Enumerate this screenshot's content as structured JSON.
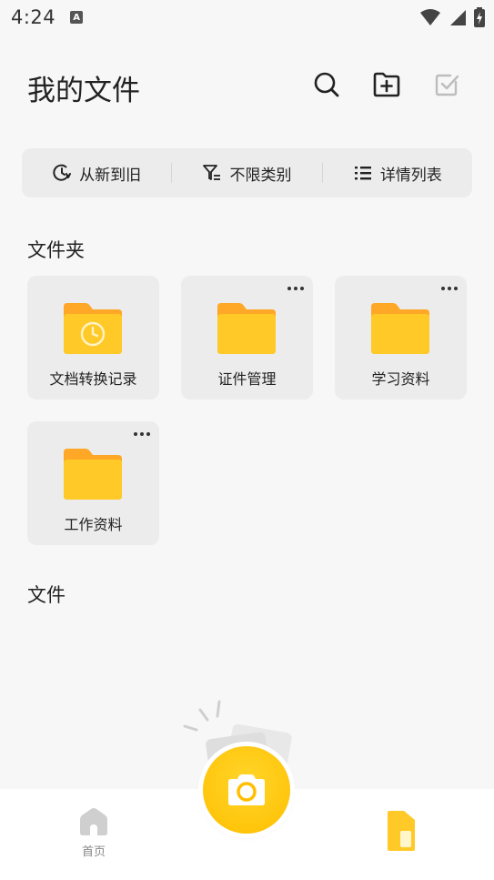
{
  "status": {
    "time": "4:24",
    "badge": "A"
  },
  "header": {
    "title": "我的文件"
  },
  "filters": {
    "sort": "从新到旧",
    "category": "不限类别",
    "view": "详情列表"
  },
  "folders_section": {
    "title": "文件夹"
  },
  "folders": [
    {
      "name": "文档转换记录",
      "icon": "folder-clock-icon",
      "has_more": false
    },
    {
      "name": "证件管理",
      "icon": "folder-icon",
      "has_more": true
    },
    {
      "name": "学习资料",
      "icon": "folder-icon",
      "has_more": true
    },
    {
      "name": "工作资料",
      "icon": "folder-icon",
      "has_more": true
    }
  ],
  "files_section": {
    "title": "文件"
  },
  "bottom_nav": {
    "home_label": "首页"
  },
  "colors": {
    "accent": "#ffc400",
    "folder": "#ffc51a",
    "background": "#f7f7f7"
  }
}
